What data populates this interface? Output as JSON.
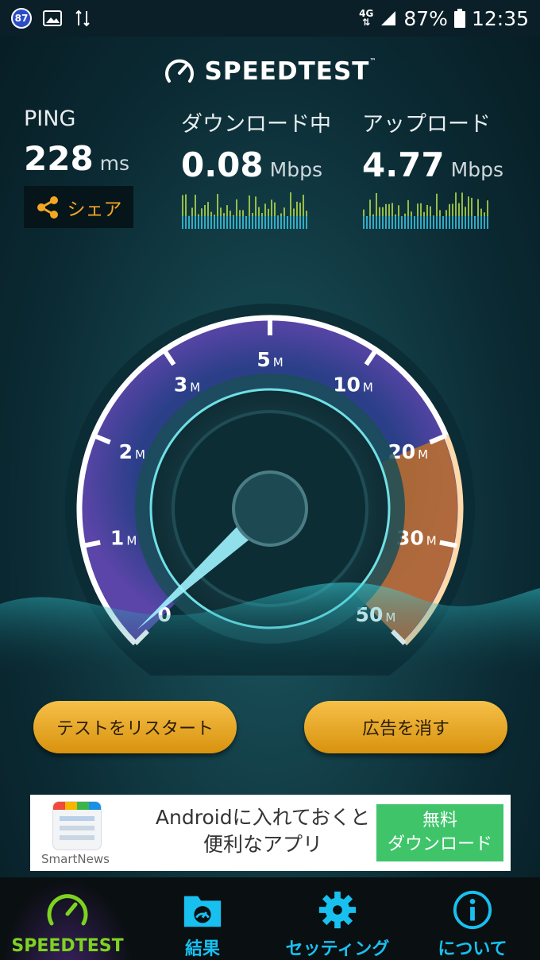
{
  "status_bar": {
    "badge": "87",
    "network": "4G",
    "battery_percent": "87%",
    "time": "12:35"
  },
  "header": {
    "title": "SPEEDTEST",
    "tm": "™"
  },
  "metrics": {
    "ping": {
      "label": "PING",
      "value": "228",
      "unit": "ms"
    },
    "download": {
      "label": "ダウンロード中",
      "value": "0.08",
      "unit": "Mbps"
    },
    "upload": {
      "label": "アップロード",
      "value": "4.77",
      "unit": "Mbps"
    }
  },
  "share": {
    "label": "シェア"
  },
  "gauge": {
    "ticks": [
      {
        "num": "0",
        "unit": ""
      },
      {
        "num": "1",
        "unit": "M"
      },
      {
        "num": "2",
        "unit": "M"
      },
      {
        "num": "3",
        "unit": "M"
      },
      {
        "num": "5",
        "unit": "M"
      },
      {
        "num": "10",
        "unit": "M"
      },
      {
        "num": "20",
        "unit": "M"
      },
      {
        "num": "30",
        "unit": "M"
      },
      {
        "num": "50",
        "unit": "M"
      }
    ],
    "current_mbps": 0.08,
    "colors": {
      "arc": "#9b7fe6",
      "orange": "#f08a2c",
      "needle": "#9ff4ff"
    }
  },
  "buttons": {
    "restart": "テストをリスタート",
    "remove_ads": "広告を消す"
  },
  "ad": {
    "text_line1": "Androidに入れておくと",
    "text_line2": "便利なアプリ",
    "brand": "SmartNews",
    "cta_line1": "無料",
    "cta_line2": "ダウンロード"
  },
  "nav": {
    "items": [
      {
        "label": "SPEEDTEST",
        "icon": "gauge-icon",
        "color": "#7ed321"
      },
      {
        "label": "結果",
        "icon": "results-icon",
        "color": "#18c0f0"
      },
      {
        "label": "セッティング",
        "icon": "gear-icon",
        "color": "#18c0f0"
      },
      {
        "label": "について",
        "icon": "info-icon",
        "color": "#18c0f0"
      }
    ]
  }
}
